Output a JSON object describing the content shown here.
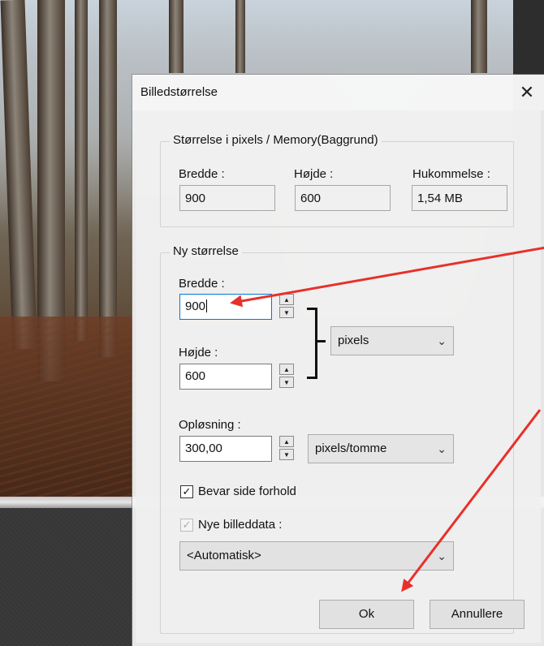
{
  "dialog": {
    "title": "Billedstørrelse",
    "close_glyph": "✕"
  },
  "current_size": {
    "legend": "Størrelse i pixels / Memory(Baggrund)",
    "width_label": "Bredde :",
    "width_value": "900",
    "height_label": "Højde :",
    "height_value": "600",
    "memory_label": "Hukommelse :",
    "memory_value": "1,54 MB"
  },
  "new_size": {
    "legend": "Ny størrelse",
    "width_label": "Bredde :",
    "width_value": "900",
    "height_label": "Højde :",
    "height_value": "600",
    "unit_selected": "pixels",
    "resolution_label": "Opløsning :",
    "resolution_value": "300,00",
    "resolution_unit_selected": "pixels/tomme",
    "keep_ratio_label": "Bevar side forhold",
    "keep_ratio_checked": true,
    "new_data_label": "Nye billeddata :",
    "new_data_checked": true,
    "new_data_selected": "<Automatisk>"
  },
  "buttons": {
    "ok": "Ok",
    "cancel": "Annullere"
  },
  "icons": {
    "spin_up": "▲",
    "spin_down": "▼",
    "dropdown": "⌄",
    "check": "✓"
  },
  "colors": {
    "annotation_arrow": "#e8302a",
    "focus_border": "#0078d7"
  }
}
